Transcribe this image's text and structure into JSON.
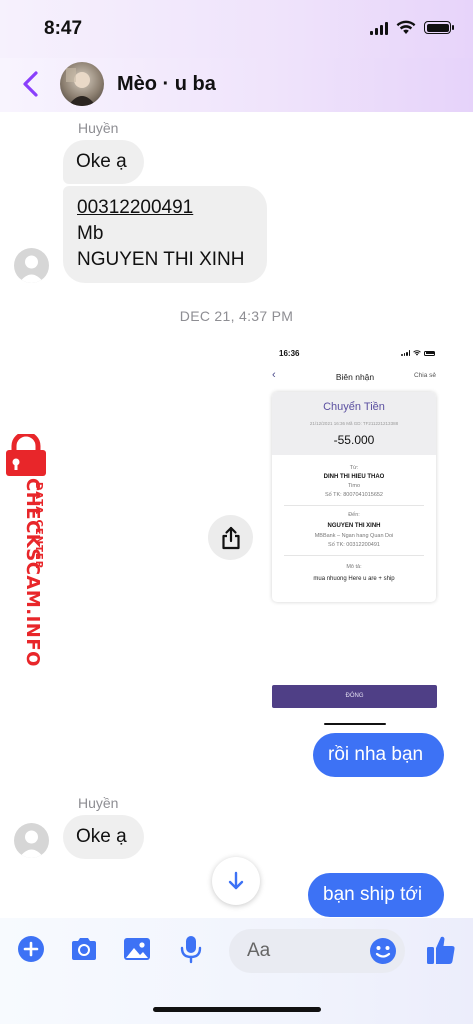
{
  "status_bar": {
    "time": "8:47"
  },
  "header": {
    "title": "Mèo · u ba"
  },
  "messages": {
    "group1_sender": "Huyền",
    "bubble1": "Oke ạ",
    "bubble2_line1": "00312200491",
    "bubble2_line2": "Mb",
    "bubble2_line3": "NGUYEN THI XINH",
    "timestamp": "DEC 21, 4:37 PM",
    "outgoing1": "rồi nha bạn",
    "group2_sender": "Huyền",
    "bubble3": "Oke ạ",
    "outgoing2": "bạn ship tới"
  },
  "receipt": {
    "status_time": "16:36",
    "nav_title": "Biên nhận",
    "nav_share": "Chia sẻ",
    "title": "Chuyển Tiền",
    "meta": "21/12/2021 16:36     Mã GD: TF211221213388",
    "amount": "-55.000",
    "from_label": "Từ:",
    "from_name": "DINH THI HIEU THAO",
    "from_bank": "Timo",
    "from_account": "Số TK: 8007041015652",
    "to_label": "Đến:",
    "to_name": "NGUYEN THI XINH",
    "to_bank": "MBBank – Ngan hang Quan Doi",
    "to_account": "Số TK: 00312200491",
    "desc_label": "Mô tả:",
    "desc_text": "mua nhuong Here u are + ship",
    "close_button": "ĐÓNG"
  },
  "watermark": {
    "main": "CHECKSCAM.INFO",
    "sub": "DATA CENTER"
  },
  "composer": {
    "placeholder": "Aa"
  },
  "colors": {
    "accent": "#3d72f5",
    "back_arrow": "#8a3ffc",
    "watermark": "#e8262a",
    "receipt_button": "#4f3f86"
  }
}
